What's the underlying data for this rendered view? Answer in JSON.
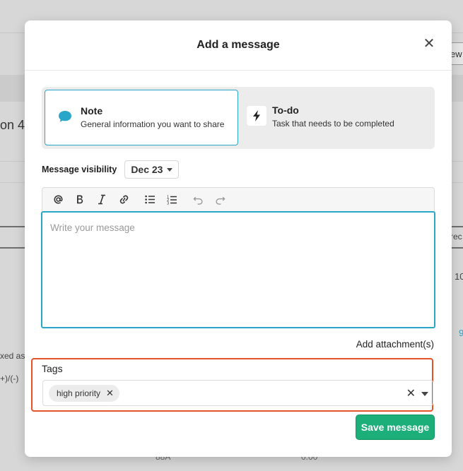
{
  "background": {
    "partial_heading": "on 4 I",
    "partial_fixed": "xed as",
    "partial_sign": "+)/(-)",
    "partial_bottom_left": "88A",
    "partial_bottom_right": "0.00",
    "partial_right_col": "rec",
    "partial_right_value": "10",
    "partial_right_link": "9",
    "partial_button": "ew"
  },
  "modal": {
    "title": "Add a message",
    "close_icon": "close-icon"
  },
  "message_types": [
    {
      "title": "Note",
      "subtitle": "General information you want to share",
      "icon": "speech-bubble-icon",
      "selected": true
    },
    {
      "title": "To-do",
      "subtitle": "Task that needs to be completed",
      "icon": "lightning-bolt-icon",
      "selected": false
    }
  ],
  "visibility": {
    "label": "Message visibility",
    "value": "Dec 23"
  },
  "toolbar": [
    "mention-icon",
    "bold-icon",
    "italic-icon",
    "link-icon",
    "bullet-list-icon",
    "numbered-list-icon",
    "undo-icon",
    "redo-icon"
  ],
  "editor": {
    "placeholder": "Write your message"
  },
  "attachment_label": "Add attachment(s)",
  "tags": {
    "label": "Tags",
    "items": [
      "high priority"
    ]
  },
  "save_label": "Save message",
  "colors": {
    "accent": "#2aa7c8",
    "highlight_border": "#e8512a",
    "save_button": "#1daf79"
  }
}
